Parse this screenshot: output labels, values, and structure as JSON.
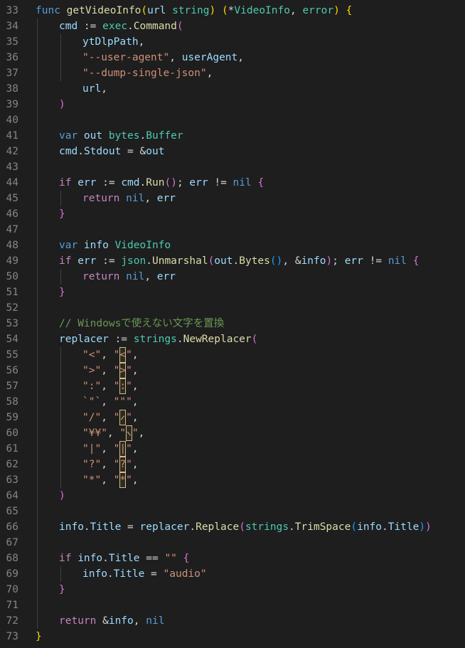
{
  "editor": {
    "lines": [
      {
        "n": "33",
        "i": 0,
        "t": [
          [
            "kw",
            "func "
          ],
          [
            "fn",
            "getVideoInfo"
          ],
          [
            "br1",
            "("
          ],
          [
            "var",
            "url "
          ],
          [
            "ty",
            "string"
          ],
          [
            "br1",
            ")"
          ],
          [
            "op",
            " "
          ],
          [
            "br1",
            "("
          ],
          [
            "op",
            "*"
          ],
          [
            "ty",
            "VideoInfo"
          ],
          [
            "op",
            ", "
          ],
          [
            "ty",
            "error"
          ],
          [
            "br1",
            ")"
          ],
          [
            "op",
            " "
          ],
          [
            "br1",
            "{"
          ]
        ]
      },
      {
        "n": "34",
        "i": 1,
        "t": [
          [
            "var",
            "cmd"
          ],
          [
            "op",
            " := "
          ],
          [
            "pk",
            "exec"
          ],
          [
            "op",
            "."
          ],
          [
            "fn",
            "Command"
          ],
          [
            "br2",
            "("
          ]
        ]
      },
      {
        "n": "35",
        "i": 2,
        "t": [
          [
            "var",
            "ytDlpPath"
          ],
          [
            "op",
            ","
          ]
        ]
      },
      {
        "n": "36",
        "i": 2,
        "t": [
          [
            "str",
            "\"--user-agent\""
          ],
          [
            "op",
            ", "
          ],
          [
            "var",
            "userAgent"
          ],
          [
            "op",
            ","
          ]
        ]
      },
      {
        "n": "37",
        "i": 2,
        "t": [
          [
            "str",
            "\"--dump-single-json\""
          ],
          [
            "op",
            ","
          ]
        ]
      },
      {
        "n": "38",
        "i": 2,
        "t": [
          [
            "var",
            "url"
          ],
          [
            "op",
            ","
          ]
        ]
      },
      {
        "n": "39",
        "i": 1,
        "t": [
          [
            "br2",
            ")"
          ]
        ]
      },
      {
        "n": "40",
        "i": 1,
        "t": []
      },
      {
        "n": "41",
        "i": 1,
        "t": [
          [
            "kw",
            "var "
          ],
          [
            "var",
            "out "
          ],
          [
            "pk",
            "bytes"
          ],
          [
            "op",
            "."
          ],
          [
            "ty",
            "Buffer"
          ]
        ]
      },
      {
        "n": "42",
        "i": 1,
        "t": [
          [
            "var",
            "cmd"
          ],
          [
            "op",
            "."
          ],
          [
            "var",
            "Stdout"
          ],
          [
            "op",
            " = &"
          ],
          [
            "var",
            "out"
          ]
        ]
      },
      {
        "n": "43",
        "i": 1,
        "t": []
      },
      {
        "n": "44",
        "i": 1,
        "t": [
          [
            "kwc",
            "if "
          ],
          [
            "var",
            "err"
          ],
          [
            "op",
            " := "
          ],
          [
            "var",
            "cmd"
          ],
          [
            "op",
            "."
          ],
          [
            "fn",
            "Run"
          ],
          [
            "br2",
            "()"
          ],
          [
            "op",
            "; "
          ],
          [
            "var",
            "err"
          ],
          [
            "op",
            " != "
          ],
          [
            "kw",
            "nil"
          ],
          [
            "op",
            " "
          ],
          [
            "br2",
            "{"
          ]
        ]
      },
      {
        "n": "45",
        "i": 2,
        "t": [
          [
            "kwc",
            "return "
          ],
          [
            "kw",
            "nil"
          ],
          [
            "op",
            ", "
          ],
          [
            "var",
            "err"
          ]
        ]
      },
      {
        "n": "46",
        "i": 1,
        "t": [
          [
            "br2",
            "}"
          ]
        ]
      },
      {
        "n": "47",
        "i": 1,
        "t": []
      },
      {
        "n": "48",
        "i": 1,
        "t": [
          [
            "kw",
            "var "
          ],
          [
            "var",
            "info "
          ],
          [
            "ty",
            "VideoInfo"
          ]
        ]
      },
      {
        "n": "49",
        "i": 1,
        "t": [
          [
            "kwc",
            "if "
          ],
          [
            "var",
            "err"
          ],
          [
            "op",
            " := "
          ],
          [
            "pk",
            "json"
          ],
          [
            "op",
            "."
          ],
          [
            "fn",
            "Unmarshal"
          ],
          [
            "br2",
            "("
          ],
          [
            "var",
            "out"
          ],
          [
            "op",
            "."
          ],
          [
            "fn",
            "Bytes"
          ],
          [
            "br3",
            "()"
          ],
          [
            "op",
            ", &"
          ],
          [
            "var",
            "info"
          ],
          [
            "br2",
            ")"
          ],
          [
            "op",
            "; "
          ],
          [
            "var",
            "err"
          ],
          [
            "op",
            " != "
          ],
          [
            "kw",
            "nil"
          ],
          [
            "op",
            " "
          ],
          [
            "br2",
            "{"
          ]
        ]
      },
      {
        "n": "50",
        "i": 2,
        "t": [
          [
            "kwc",
            "return "
          ],
          [
            "kw",
            "nil"
          ],
          [
            "op",
            ", "
          ],
          [
            "var",
            "err"
          ]
        ]
      },
      {
        "n": "51",
        "i": 1,
        "t": [
          [
            "br2",
            "}"
          ]
        ]
      },
      {
        "n": "52",
        "i": 1,
        "t": []
      },
      {
        "n": "53",
        "i": 1,
        "t": [
          [
            "cm",
            "// Windowsで使えない文字を置換"
          ]
        ]
      },
      {
        "n": "54",
        "i": 1,
        "t": [
          [
            "var",
            "replacer"
          ],
          [
            "op",
            " := "
          ],
          [
            "pk",
            "strings"
          ],
          [
            "op",
            "."
          ],
          [
            "fn",
            "NewReplacer"
          ],
          [
            "br2",
            "("
          ]
        ]
      },
      {
        "n": "55",
        "i": 2,
        "t": [
          [
            "str",
            "\"<\""
          ],
          [
            "op",
            ", "
          ],
          [
            "str",
            "\""
          ],
          [
            "uni",
            "<"
          ],
          [
            "str",
            "\""
          ],
          [
            "op",
            ","
          ]
        ]
      },
      {
        "n": "56",
        "i": 2,
        "t": [
          [
            "str",
            "\">\""
          ],
          [
            "op",
            ", "
          ],
          [
            "str",
            "\""
          ],
          [
            "uni",
            ">"
          ],
          [
            "str",
            "\""
          ],
          [
            "op",
            ","
          ]
        ]
      },
      {
        "n": "57",
        "i": 2,
        "t": [
          [
            "str",
            "\":\""
          ],
          [
            "op",
            ", "
          ],
          [
            "str",
            "\""
          ],
          [
            "uni",
            ":"
          ],
          [
            "str",
            "\""
          ],
          [
            "op",
            ","
          ]
        ]
      },
      {
        "n": "58",
        "i": 2,
        "t": [
          [
            "str",
            "`\"`"
          ],
          [
            "op",
            ", "
          ],
          [
            "str",
            "\"\"\""
          ],
          [
            "op",
            ","
          ]
        ]
      },
      {
        "n": "59",
        "i": 2,
        "t": [
          [
            "str",
            "\"/\""
          ],
          [
            "op",
            ", "
          ],
          [
            "str",
            "\""
          ],
          [
            "unis",
            "/"
          ],
          [
            "str",
            "\""
          ],
          [
            "op",
            ","
          ]
        ]
      },
      {
        "n": "60",
        "i": 2,
        "t": [
          [
            "str",
            "\"¥¥\""
          ],
          [
            "op",
            ", "
          ],
          [
            "str",
            "\""
          ],
          [
            "unib",
            "\\"
          ],
          [
            "str",
            "\""
          ],
          [
            "op",
            ","
          ]
        ]
      },
      {
        "n": "61",
        "i": 2,
        "t": [
          [
            "str",
            "\"|\""
          ],
          [
            "op",
            ", "
          ],
          [
            "str",
            "\""
          ],
          [
            "uni",
            "|"
          ],
          [
            "str",
            "\""
          ],
          [
            "op",
            ","
          ]
        ]
      },
      {
        "n": "62",
        "i": 2,
        "t": [
          [
            "str",
            "\"?\""
          ],
          [
            "op",
            ", "
          ],
          [
            "str",
            "\""
          ],
          [
            "uni",
            "?"
          ],
          [
            "str",
            "\""
          ],
          [
            "op",
            ","
          ]
        ]
      },
      {
        "n": "63",
        "i": 2,
        "t": [
          [
            "str",
            "\"*\""
          ],
          [
            "op",
            ", "
          ],
          [
            "str",
            "\""
          ],
          [
            "uni",
            "*"
          ],
          [
            "str",
            "\""
          ],
          [
            "op",
            ","
          ]
        ]
      },
      {
        "n": "64",
        "i": 1,
        "t": [
          [
            "br2",
            ")"
          ]
        ]
      },
      {
        "n": "65",
        "i": 1,
        "t": []
      },
      {
        "n": "66",
        "i": 1,
        "t": [
          [
            "var",
            "info"
          ],
          [
            "op",
            "."
          ],
          [
            "var",
            "Title"
          ],
          [
            "op",
            " = "
          ],
          [
            "var",
            "replacer"
          ],
          [
            "op",
            "."
          ],
          [
            "fn",
            "Replace"
          ],
          [
            "br2",
            "("
          ],
          [
            "pk",
            "strings"
          ],
          [
            "op",
            "."
          ],
          [
            "fn",
            "TrimSpace"
          ],
          [
            "br3",
            "("
          ],
          [
            "var",
            "info"
          ],
          [
            "op",
            "."
          ],
          [
            "var",
            "Title"
          ],
          [
            "br3",
            ")"
          ],
          [
            "br2",
            ")"
          ]
        ]
      },
      {
        "n": "67",
        "i": 1,
        "t": []
      },
      {
        "n": "68",
        "i": 1,
        "t": [
          [
            "kwc",
            "if "
          ],
          [
            "var",
            "info"
          ],
          [
            "op",
            "."
          ],
          [
            "var",
            "Title"
          ],
          [
            "op",
            " == "
          ],
          [
            "str",
            "\"\""
          ],
          [
            "op",
            " "
          ],
          [
            "br2",
            "{"
          ]
        ]
      },
      {
        "n": "69",
        "i": 2,
        "t": [
          [
            "var",
            "info"
          ],
          [
            "op",
            "."
          ],
          [
            "var",
            "Title"
          ],
          [
            "op",
            " = "
          ],
          [
            "str",
            "\"audio\""
          ]
        ]
      },
      {
        "n": "70",
        "i": 1,
        "t": [
          [
            "br2",
            "}"
          ]
        ]
      },
      {
        "n": "71",
        "i": 1,
        "t": []
      },
      {
        "n": "72",
        "i": 1,
        "t": [
          [
            "kwc",
            "return "
          ],
          [
            "op",
            "&"
          ],
          [
            "var",
            "info"
          ],
          [
            "op",
            ", "
          ],
          [
            "kw",
            "nil"
          ]
        ]
      },
      {
        "n": "73",
        "i": 0,
        "t": [
          [
            "br1",
            "}"
          ]
        ]
      }
    ]
  }
}
